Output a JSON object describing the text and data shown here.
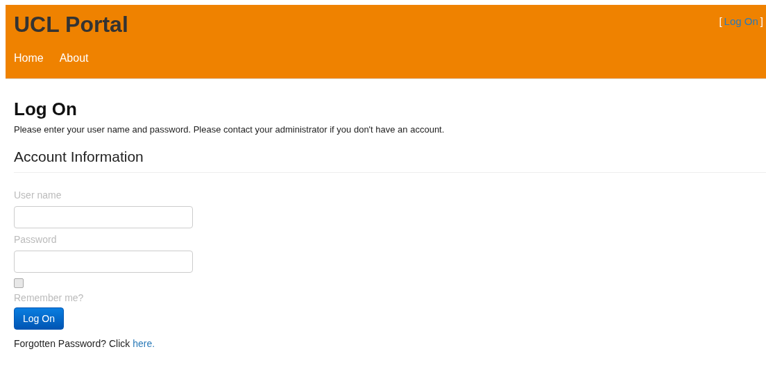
{
  "header": {
    "title": "UCL Portal",
    "login_link": {
      "open": "[",
      "label": "Log On",
      "close": "]"
    },
    "nav": [
      {
        "label": "Home"
      },
      {
        "label": "About"
      }
    ]
  },
  "page": {
    "heading": "Log On",
    "intro": "Please enter your user name and password. Please contact your administrator if you don't have an account.",
    "section": "Account Information",
    "fields": [
      {
        "label": "User name"
      },
      {
        "label": "Password"
      }
    ],
    "remember": {
      "checked": false,
      "label": "Remember me?"
    },
    "button": "Log On",
    "forgot": {
      "text": "Forgotten Password? Click",
      "link": "here."
    }
  }
}
